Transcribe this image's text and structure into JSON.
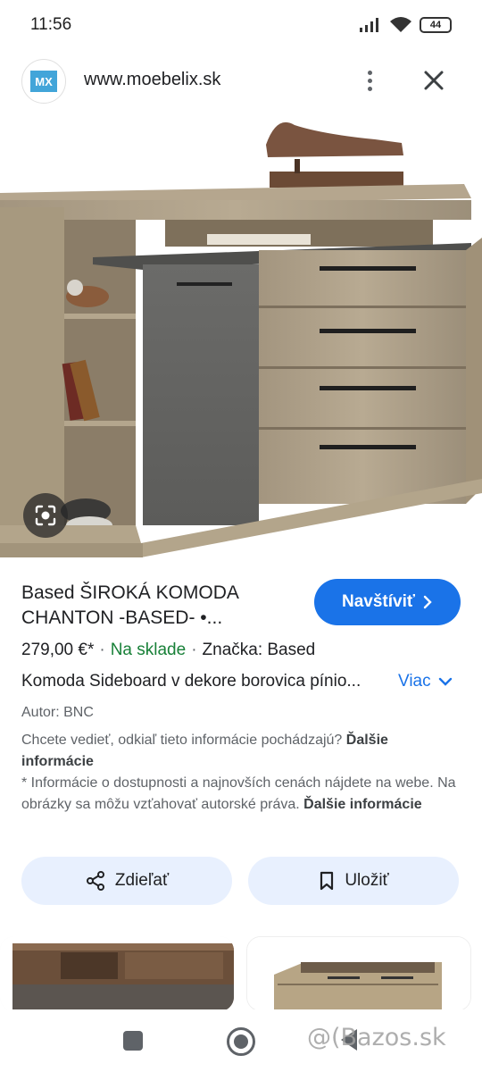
{
  "status_bar": {
    "time": "11:56",
    "battery": "44"
  },
  "site": {
    "logo_text": "MX",
    "url": "www.moebelix.sk"
  },
  "product": {
    "title": "Based ŠIROKÁ KOMODA CHANTON -BASED- •...",
    "visit_label": "Navštíviť",
    "price": "279,00 €*",
    "stock": "Na sklade",
    "brand": "Značka: Based",
    "description": "Komoda Sideboard v dekore borovica pínio...",
    "more_label": "Viac",
    "author": "Autor: BNC"
  },
  "info": {
    "question": "Chcete vedieť, odkiaľ tieto informácie pochádzajú?",
    "question_link": "Ďalšie informácie",
    "notice": "* Informácie o dostupnosti a najnovších cenách nájdete na webe. Na obrázky sa môžu vzťahovať autorské práva.",
    "notice_link": "Ďalšie informácie"
  },
  "actions": {
    "share_label": "Zdieľať",
    "save_label": "Uložiť"
  },
  "watermark": "@(Bazos.sk",
  "colors": {
    "primary": "#1a73e8",
    "stock_green": "#188038",
    "pill_bg": "#e8f0fe",
    "logo_blue": "#42a5d9"
  },
  "icons": [
    "signal-icon",
    "wifi-icon",
    "battery-icon",
    "more-vert-icon",
    "close-icon",
    "lens-icon",
    "chevron-right-icon",
    "chevron-down-icon",
    "share-icon",
    "bookmark-icon"
  ]
}
